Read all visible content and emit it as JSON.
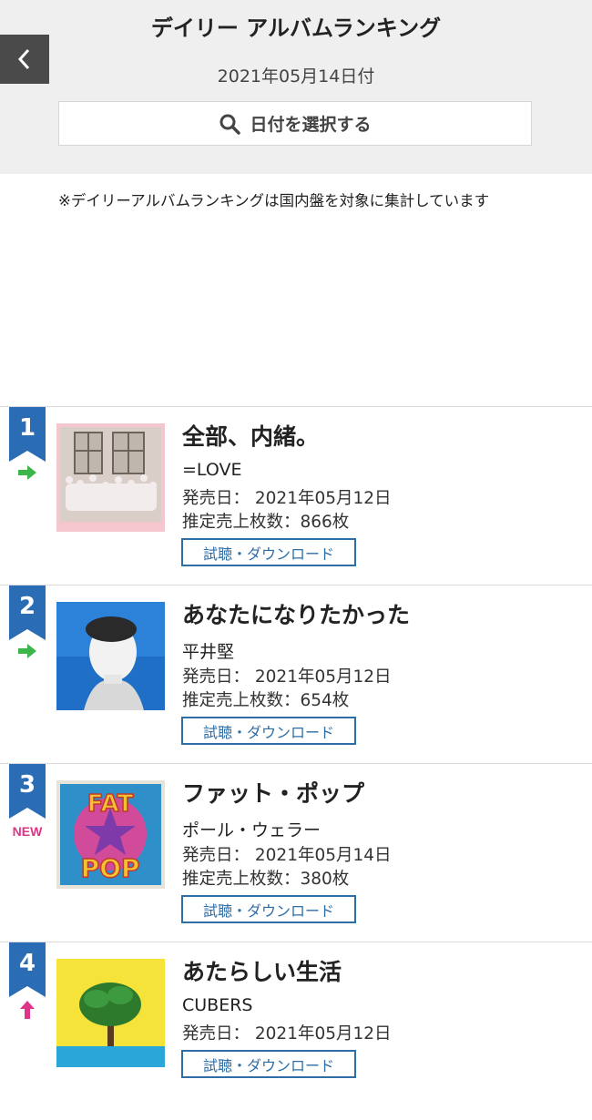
{
  "header": {
    "title": "デイリー アルバムランキング",
    "date": "2021年05月14日付",
    "date_select_label": "日付を選択する"
  },
  "note": "※デイリーアルバムランキングは国内盤を対象に集計しています",
  "colors": {
    "header_bg": "#efefef",
    "badge_blue": "#2a6db5",
    "trend_same": "#3cb54a",
    "trend_up": "#e0348a",
    "button_border": "#2e6ea6"
  },
  "rankings": [
    {
      "rank": "1",
      "trend": "same",
      "trend_icon": "right-arrow-icon",
      "title": "全部、内緒。",
      "artist": "=LOVE",
      "release": "発売日： 2021年05月12日",
      "sales": "推定売上枚数：866枚",
      "button": "試聴・ダウンロード"
    },
    {
      "rank": "2",
      "trend": "same",
      "trend_icon": "right-arrow-icon",
      "title": "あなたになりたかった",
      "artist": "平井堅",
      "release": "発売日： 2021年05月12日",
      "sales": "推定売上枚数：654枚",
      "button": "試聴・ダウンロード"
    },
    {
      "rank": "3",
      "trend": "new",
      "trend_label": "NEW",
      "title": "ファット・ポップ",
      "artist": "ポール・ウェラー",
      "release": "発売日： 2021年05月14日",
      "sales": "推定売上枚数：380枚",
      "button": "試聴・ダウンロード",
      "cover_text_1": "FAT",
      "cover_text_2": "POP"
    },
    {
      "rank": "4",
      "trend": "up",
      "trend_icon": "up-arrow-icon",
      "title": "あたらしい生活",
      "artist": "CUBERS",
      "release": "発売日： 2021年05月12日",
      "button": "試聴・ダウンロード"
    }
  ]
}
